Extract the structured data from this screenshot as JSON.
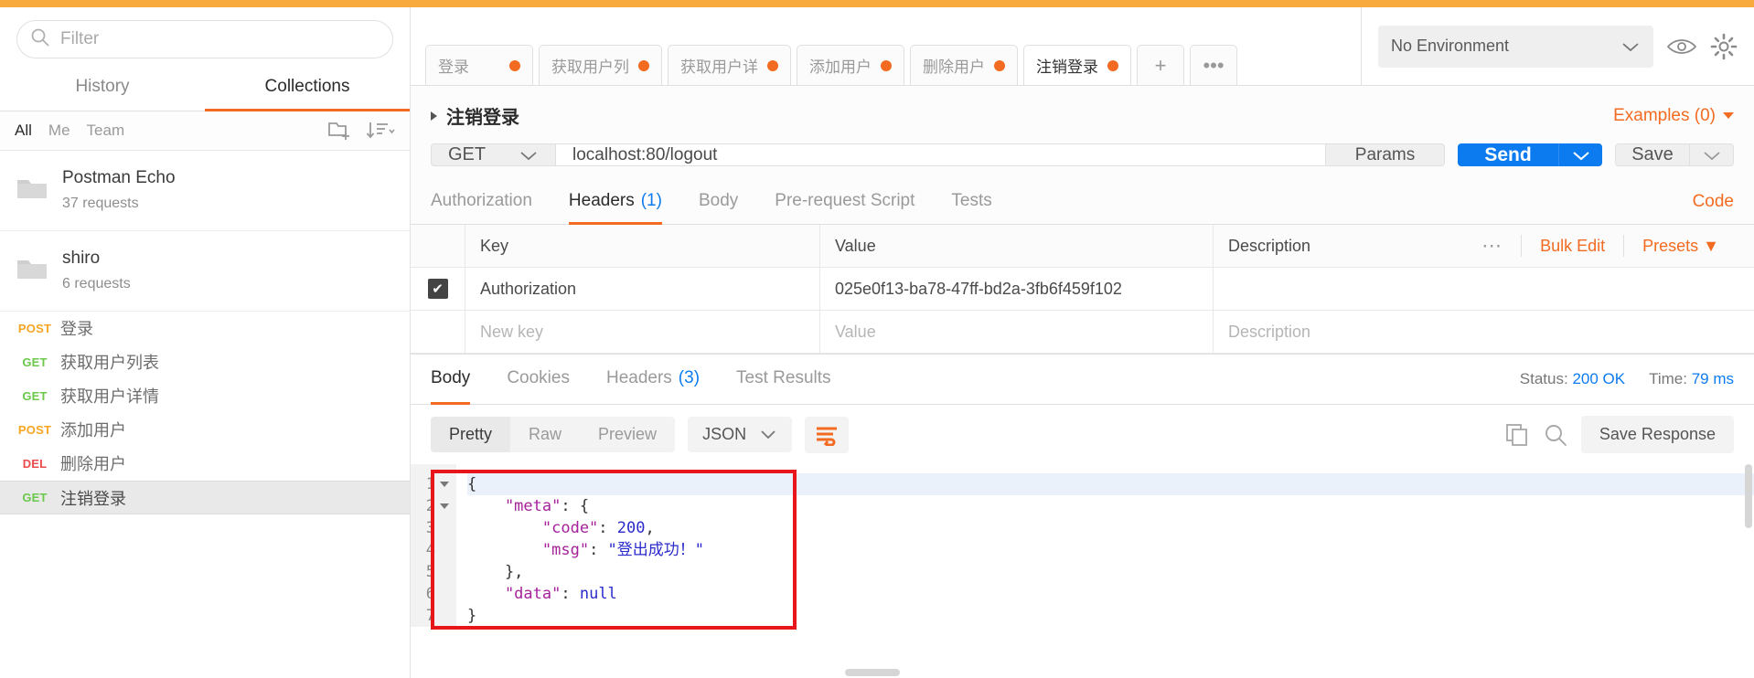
{
  "sidebar": {
    "filter_placeholder": "Filter",
    "tabs": [
      {
        "label": "History",
        "active": false
      },
      {
        "label": "Collections",
        "active": true
      }
    ],
    "scopes": [
      {
        "label": "All",
        "active": true
      },
      {
        "label": "Me",
        "active": false
      },
      {
        "label": "Team",
        "active": false
      }
    ],
    "new_folder_icon": "new-folder-icon",
    "sort_icon": "sort-descending-icon",
    "collections": [
      {
        "name": "Postman Echo",
        "count": "37 requests"
      },
      {
        "name": "shiro",
        "count": "6 requests"
      }
    ],
    "requests": [
      {
        "method": "POST",
        "name": "登录",
        "selected": false
      },
      {
        "method": "GET",
        "name": "获取用户列表",
        "selected": false
      },
      {
        "method": "GET",
        "name": "获取用户详情",
        "selected": false
      },
      {
        "method": "POST",
        "name": "添加用户",
        "selected": false
      },
      {
        "method": "DEL",
        "name": "删除用户",
        "selected": false
      },
      {
        "method": "GET",
        "name": "注销登录",
        "selected": true
      }
    ]
  },
  "tabstrip": {
    "tabs": [
      {
        "label": "登录",
        "active": false
      },
      {
        "label": "获取用户列",
        "active": false
      },
      {
        "label": "获取用户详",
        "active": false
      },
      {
        "label": "添加用户",
        "active": false
      },
      {
        "label": "删除用户",
        "active": false
      },
      {
        "label": "注销登录",
        "active": true
      }
    ],
    "add_label": "+",
    "more_label": "•••"
  },
  "environment": {
    "selected": "No Environment",
    "eye_icon": "eye-icon",
    "settings_icon": "gear-icon"
  },
  "request": {
    "title": "注销登录",
    "examples_label": "Examples (0)",
    "method": "GET",
    "url": "localhost:80/logout",
    "params_label": "Params",
    "send_label": "Send",
    "save_label": "Save",
    "tabs": [
      {
        "label": "Authorization",
        "count": "",
        "active": false
      },
      {
        "label": "Headers",
        "count": "(1)",
        "active": true
      },
      {
        "label": "Body",
        "count": "",
        "active": false
      },
      {
        "label": "Pre-request Script",
        "count": "",
        "active": false
      },
      {
        "label": "Tests",
        "count": "",
        "active": false
      }
    ],
    "code_link": "Code"
  },
  "headers_table": {
    "columns": {
      "key": "Key",
      "value": "Value",
      "description": "Description"
    },
    "bulk_edit": "Bulk Edit",
    "presets": "Presets ▼",
    "more_icon": "more-horizontal-icon",
    "rows": [
      {
        "checked": true,
        "key": "Authorization",
        "value": "025e0f13-ba78-47ff-bd2a-3fb6f459f102",
        "description": ""
      }
    ],
    "new_row": {
      "key_placeholder": "New key",
      "value_placeholder": "Value",
      "description_placeholder": "Description"
    }
  },
  "response": {
    "tabs": [
      {
        "label": "Body",
        "count": "",
        "active": true
      },
      {
        "label": "Cookies",
        "count": "",
        "active": false
      },
      {
        "label": "Headers",
        "count": "(3)",
        "active": false
      },
      {
        "label": "Test Results",
        "count": "",
        "active": false
      }
    ],
    "status_label": "Status:",
    "status_value": "200 OK",
    "time_label": "Time:",
    "time_value": "79 ms",
    "view_modes": [
      {
        "label": "Pretty",
        "active": true
      },
      {
        "label": "Raw",
        "active": false
      },
      {
        "label": "Preview",
        "active": false
      }
    ],
    "format": "JSON",
    "wrap_icon": "word-wrap-icon",
    "copy_icon": "copy-icon",
    "search_icon": "search-icon",
    "save_response": "Save Response",
    "body_lines": [
      {
        "n": "1",
        "fold": true,
        "text": "{"
      },
      {
        "n": "2",
        "fold": true,
        "text": "    \"meta\": {"
      },
      {
        "n": "3",
        "fold": false,
        "text": "        \"code\": 200,"
      },
      {
        "n": "4",
        "fold": false,
        "text": "        \"msg\": \"登出成功！\""
      },
      {
        "n": "5",
        "fold": false,
        "text": "    },"
      },
      {
        "n": "6",
        "fold": false,
        "text": "    \"data\": null"
      },
      {
        "n": "7",
        "fold": false,
        "text": "}"
      }
    ],
    "body_json": {
      "meta": {
        "code": 200,
        "msg": "登出成功！"
      },
      "data": null
    }
  },
  "colors": {
    "accent_orange": "#f26b21",
    "send_blue": "#0d7bf0",
    "get_green": "#6bc84a",
    "post_orange": "#f5a623",
    "del_red": "#ea4b4b",
    "highlight_box": "#e8161b"
  }
}
